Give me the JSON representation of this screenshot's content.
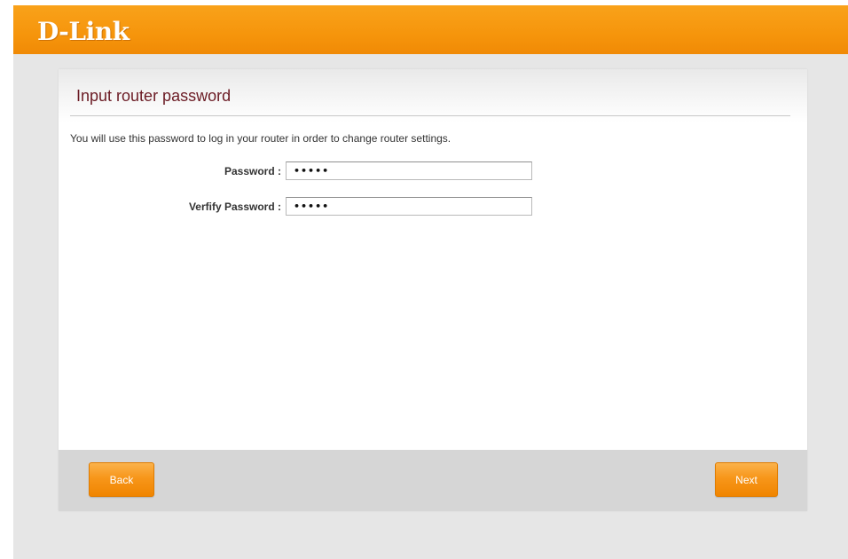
{
  "header": {
    "logo_text": "D-Link"
  },
  "page": {
    "title": "Input router password",
    "description": "You will use this password to log in your router in order to change router settings."
  },
  "form": {
    "password": {
      "label": "Password :",
      "value": "•••••"
    },
    "verify_password": {
      "label": "Verfify Password :",
      "value": "•••••"
    }
  },
  "footer": {
    "back_label": "Back",
    "next_label": "Next"
  },
  "colors": {
    "brand_orange": "#f6950c",
    "title_color": "#6b1b24"
  }
}
